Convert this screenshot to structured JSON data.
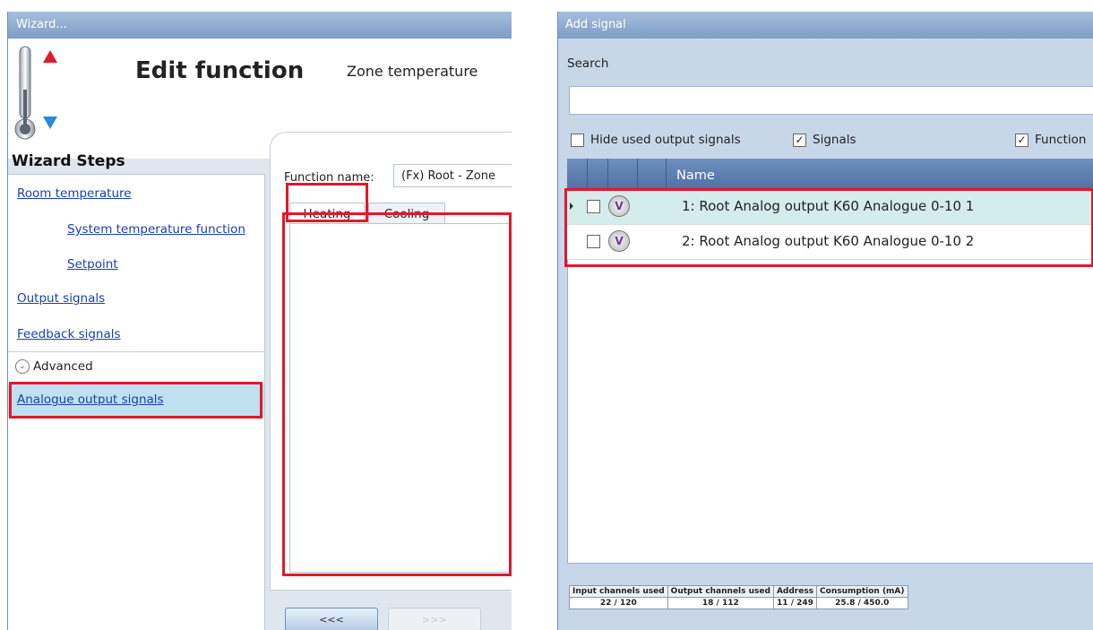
{
  "wizard": {
    "window_title": "Wizard...",
    "title": "Edit function",
    "subtitle": "Zone temperature",
    "steps_heading": "Wizard Steps",
    "steps": [
      {
        "label": "Room temperature"
      },
      {
        "label": "System temperature function"
      },
      {
        "label": "Setpoint"
      },
      {
        "label": "Output signals"
      },
      {
        "label": "Feedback signals"
      }
    ],
    "advanced_label": "Advanced",
    "selected_step": "Analogue output signals",
    "function_name_label": "Function name:",
    "function_name_value": "(Fx) Root - Zone",
    "tabs": [
      {
        "label": "Heating"
      },
      {
        "label": "Cooling"
      }
    ],
    "back_button": "<<<",
    "next_button": ">>>",
    "icons": {
      "thermometer": "thermometer-icon",
      "expand": "chevron-down-icon"
    }
  },
  "add_signal": {
    "window_title": "Add signal",
    "search_label": "Search",
    "search_value": "",
    "filters": [
      {
        "label": "Hide used output signals",
        "checked": false
      },
      {
        "label": "Signals",
        "checked": true
      },
      {
        "label": "Function",
        "checked": true
      }
    ],
    "column_name": "Name",
    "rows": [
      {
        "name": "1: Root Analog output K60 Analogue 0-10 1",
        "checked": false,
        "icon": "voltage-icon",
        "icon_text": "V"
      },
      {
        "name": "2: Root Analog output K60 Analogue 0-10 2",
        "checked": false,
        "icon": "voltage-icon",
        "icon_text": "V"
      }
    ],
    "stats": {
      "headers": [
        "Input channels used",
        "Output channels used",
        "Address",
        "Consumption (mA)"
      ],
      "values": [
        "22 / 120",
        "18 / 112",
        "11 / 249",
        "25.8 / 450.0"
      ]
    }
  },
  "colors": {
    "highlight": "#e0192c",
    "selected_row": "#bfe0ef",
    "link": "#1a3fb0",
    "grid_header": "#5a7db0"
  }
}
